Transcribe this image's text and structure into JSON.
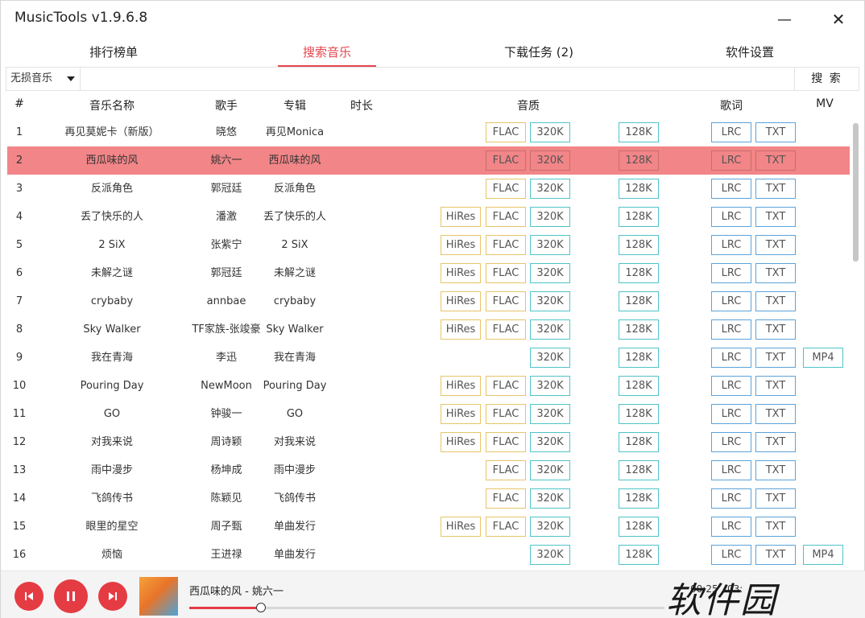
{
  "app": {
    "title": "MusicTools v1.9.6.8"
  },
  "window_controls": {
    "minimize": "—",
    "close": "✕"
  },
  "tabs": [
    {
      "label": "排行榜单",
      "active": false
    },
    {
      "label": "搜索音乐",
      "active": true
    },
    {
      "label": "下载任务 (2)",
      "active": false
    },
    {
      "label": "软件设置",
      "active": false
    }
  ],
  "search": {
    "source": "无损音乐",
    "value": "",
    "placeholder": "",
    "button": "搜 索"
  },
  "table": {
    "columns": {
      "index": "#",
      "name": "音乐名称",
      "singer": "歌手",
      "album": "专辑",
      "duration": "时长",
      "quality": "音质",
      "lyrics": "歌词",
      "mv": "MV"
    },
    "selected_index": 1,
    "rows": [
      {
        "no": "1",
        "name": "再见莫妮卡（新版）",
        "singer": "晓悠",
        "album": "再见Monica",
        "hires": "",
        "flac": "FLAC",
        "q320": "320K",
        "q128": "128K",
        "lrc": "LRC",
        "txt": "TXT",
        "mv": ""
      },
      {
        "no": "2",
        "name": "西瓜味的风",
        "singer": "姚六一",
        "album": "西瓜味的风",
        "hires": "",
        "flac": "FLAC",
        "q320": "320K",
        "q128": "128K",
        "lrc": "LRC",
        "txt": "TXT",
        "mv": ""
      },
      {
        "no": "3",
        "name": "反派角色",
        "singer": "郭冠廷",
        "album": "反派角色",
        "hires": "",
        "flac": "FLAC",
        "q320": "320K",
        "q128": "128K",
        "lrc": "LRC",
        "txt": "TXT",
        "mv": ""
      },
      {
        "no": "4",
        "name": "丢了快乐的人",
        "singer": "潘激",
        "album": "丢了快乐的人",
        "hires": "HiRes",
        "flac": "FLAC",
        "q320": "320K",
        "q128": "128K",
        "lrc": "LRC",
        "txt": "TXT",
        "mv": ""
      },
      {
        "no": "5",
        "name": "2 SiX",
        "singer": "张紫宁",
        "album": "2 SiX",
        "hires": "HiRes",
        "flac": "FLAC",
        "q320": "320K",
        "q128": "128K",
        "lrc": "LRC",
        "txt": "TXT",
        "mv": ""
      },
      {
        "no": "6",
        "name": "未解之谜",
        "singer": "郭冠廷",
        "album": "未解之谜",
        "hires": "HiRes",
        "flac": "FLAC",
        "q320": "320K",
        "q128": "128K",
        "lrc": "LRC",
        "txt": "TXT",
        "mv": ""
      },
      {
        "no": "7",
        "name": "crybaby",
        "singer": "annbae",
        "album": "crybaby",
        "hires": "HiRes",
        "flac": "FLAC",
        "q320": "320K",
        "q128": "128K",
        "lrc": "LRC",
        "txt": "TXT",
        "mv": ""
      },
      {
        "no": "8",
        "name": "Sky Walker",
        "singer": "TF家族-张竣豪",
        "album": "Sky Walker",
        "hires": "HiRes",
        "flac": "FLAC",
        "q320": "320K",
        "q128": "128K",
        "lrc": "LRC",
        "txt": "TXT",
        "mv": ""
      },
      {
        "no": "9",
        "name": "我在青海",
        "singer": "李迅",
        "album": "我在青海",
        "hires": "",
        "flac": "",
        "q320": "320K",
        "q128": "128K",
        "lrc": "LRC",
        "txt": "TXT",
        "mv": "MP4"
      },
      {
        "no": "10",
        "name": "Pouring Day",
        "singer": "NewMoon",
        "album": "Pouring Day",
        "hires": "HiRes",
        "flac": "FLAC",
        "q320": "320K",
        "q128": "128K",
        "lrc": "LRC",
        "txt": "TXT",
        "mv": ""
      },
      {
        "no": "11",
        "name": "GO",
        "singer": "钟骏一",
        "album": "GO",
        "hires": "HiRes",
        "flac": "FLAC",
        "q320": "320K",
        "q128": "128K",
        "lrc": "LRC",
        "txt": "TXT",
        "mv": ""
      },
      {
        "no": "12",
        "name": "对我来说",
        "singer": "周诗颖",
        "album": "对我来说",
        "hires": "HiRes",
        "flac": "FLAC",
        "q320": "320K",
        "q128": "128K",
        "lrc": "LRC",
        "txt": "TXT",
        "mv": ""
      },
      {
        "no": "13",
        "name": "雨中漫步",
        "singer": "杨坤成",
        "album": "雨中漫步",
        "hires": "",
        "flac": "FLAC",
        "q320": "320K",
        "q128": "128K",
        "lrc": "LRC",
        "txt": "TXT",
        "mv": ""
      },
      {
        "no": "14",
        "name": "飞鸽传书",
        "singer": "陈颖见",
        "album": "飞鸽传书",
        "hires": "",
        "flac": "FLAC",
        "q320": "320K",
        "q128": "128K",
        "lrc": "LRC",
        "txt": "TXT",
        "mv": ""
      },
      {
        "no": "15",
        "name": "眼里的星空",
        "singer": "周子甄",
        "album": "单曲发行",
        "hires": "HiRes",
        "flac": "FLAC",
        "q320": "320K",
        "q128": "128K",
        "lrc": "LRC",
        "txt": "TXT",
        "mv": ""
      },
      {
        "no": "16",
        "name": "烦恼",
        "singer": "王进禄",
        "album": "单曲发行",
        "hires": "",
        "flac": "",
        "q320": "320K",
        "q128": "128K",
        "lrc": "LRC",
        "txt": "TXT",
        "mv": "MP4"
      }
    ]
  },
  "player": {
    "now_playing": "西瓜味的风 - 姚六一",
    "elapsed": "00:25",
    "duration": "03:",
    "progress_fraction": 0.15
  },
  "watermark": {
    "text": "软件园"
  },
  "colors": {
    "accent": "#e5454d",
    "selected_row": "#f28587",
    "hires_border": "#e8c46a",
    "quality_border": "#4fc3c9",
    "lyric_border": "#5ba3d9"
  },
  "icons": {
    "prev": "skip-previous-icon",
    "pause": "pause-icon",
    "next": "skip-next-icon",
    "dropdown": "caret-down-icon",
    "close": "close-icon",
    "minimize": "minimize-icon"
  }
}
